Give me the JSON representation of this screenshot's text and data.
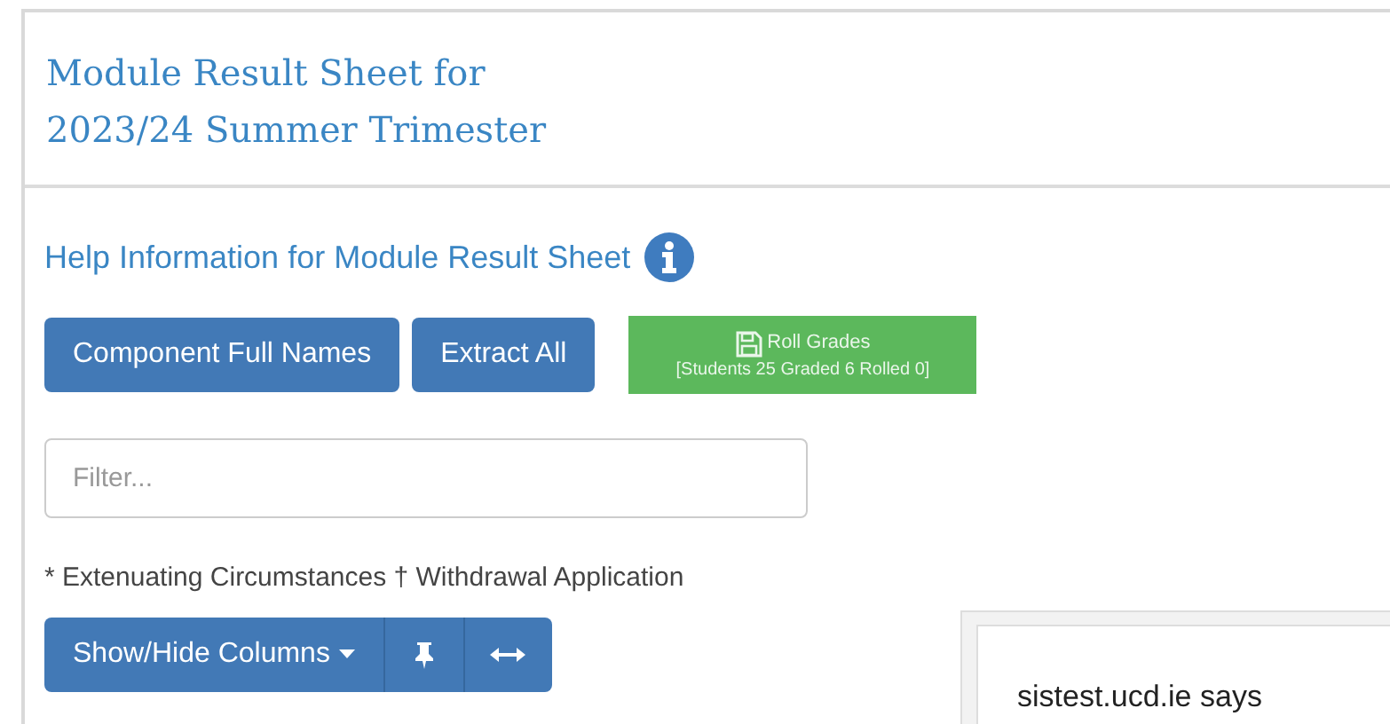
{
  "panel": {
    "title_lines": [
      "Module Result Sheet for",
      "2023/24 Summer Trimester"
    ]
  },
  "help_link": "Help Information for Module Result Sheet",
  "buttons": [
    "Component Full Names",
    "Extract All"
  ],
  "roll_grades": {
    "label": "Roll Grades",
    "summary": "[Students 25 Graded 6 Rolled 0]"
  },
  "filter": {
    "placeholder": "Filter..."
  },
  "legend": "* Extenuating Circumstances † Withdrawal Application",
  "column_toolbar": {
    "label": "Show/Hide Columns"
  },
  "dialog": {
    "title": "sistest.ucd.ie says"
  }
}
